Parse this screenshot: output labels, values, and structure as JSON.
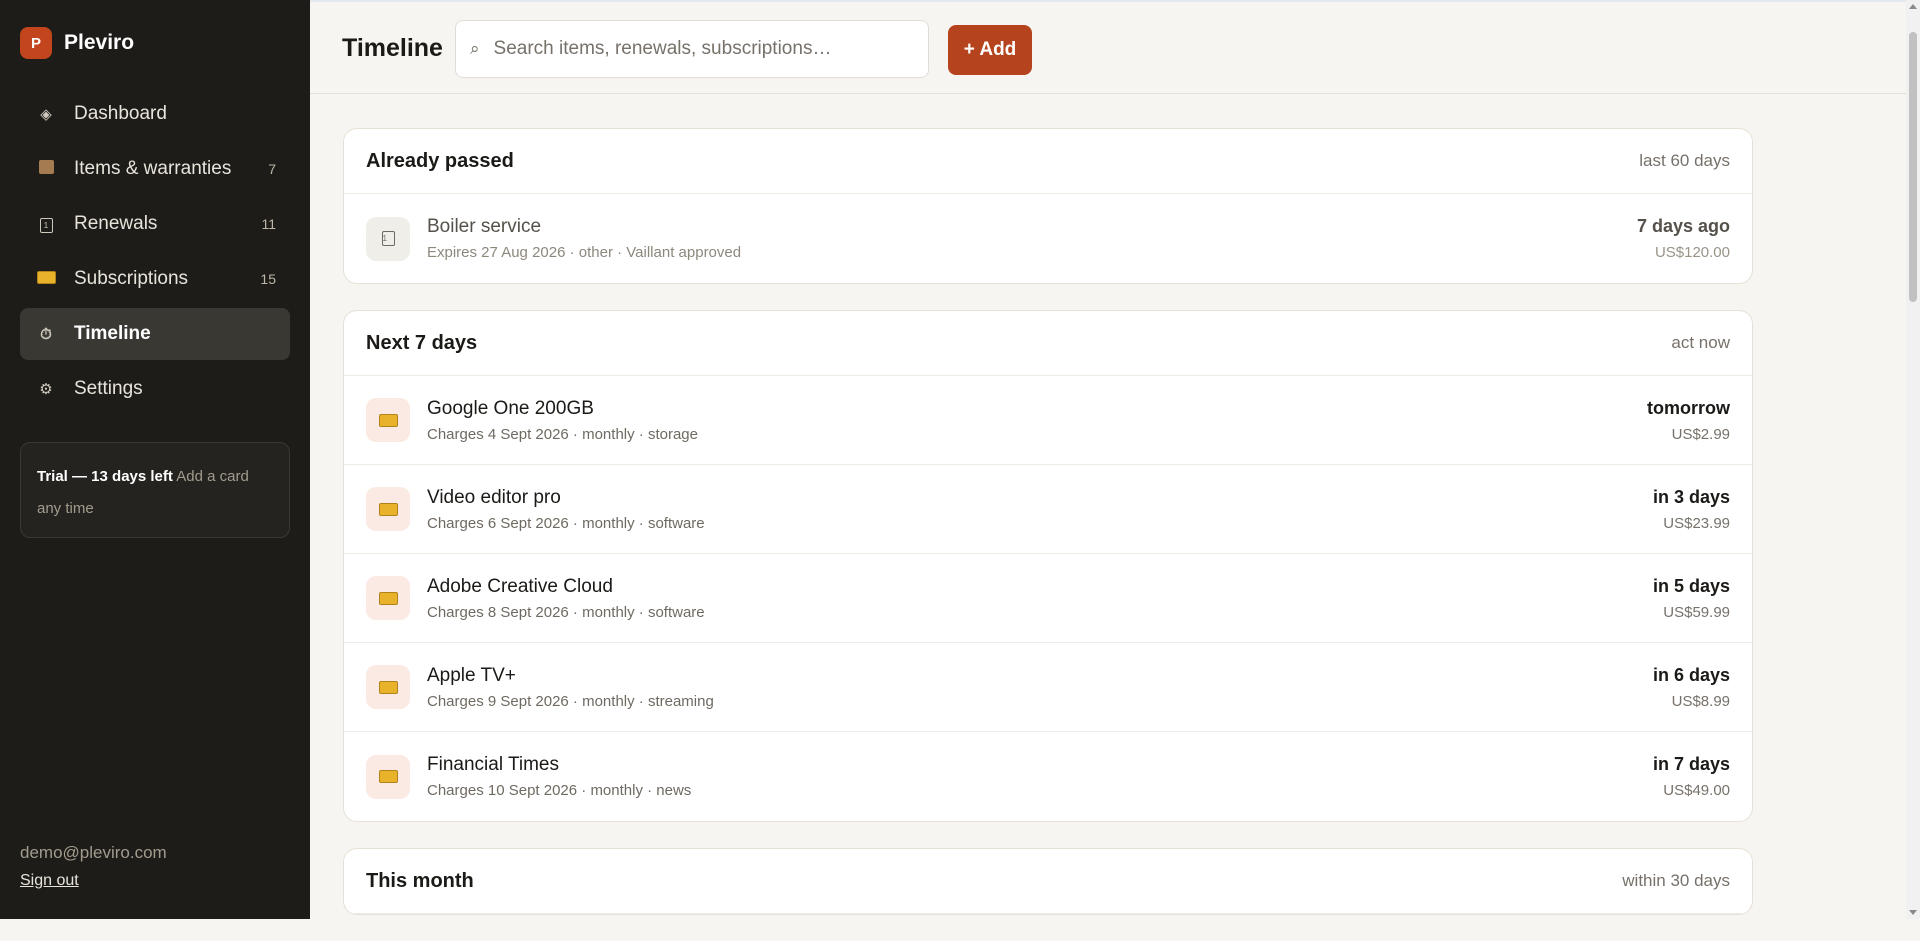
{
  "app": {
    "name": "Pleviro",
    "logo_letter": "P"
  },
  "sidebar": {
    "items": [
      {
        "label": "Dashboard",
        "icon": "diamond-icon",
        "count": ""
      },
      {
        "label": "Items & warranties",
        "icon": "box-icon",
        "count": "7"
      },
      {
        "label": "Renewals",
        "icon": "calendar-icon",
        "count": "11"
      },
      {
        "label": "Subscriptions",
        "icon": "credit-card-icon",
        "count": "15"
      },
      {
        "label": "Timeline",
        "icon": "stopwatch-icon",
        "count": "",
        "active": true
      },
      {
        "label": "Settings",
        "icon": "gear-icon",
        "count": ""
      }
    ],
    "trial": {
      "strong": "Trial — 13 days left",
      "muted": "Add a card any time"
    },
    "user_email": "demo@pleviro.com",
    "sign_out": "Sign out"
  },
  "header": {
    "title": "Timeline",
    "search_placeholder": "Search items, renewals, subscriptions…",
    "add_label": "+ Add"
  },
  "sections": [
    {
      "title": "Already passed",
      "subtitle": "last 60 days",
      "rows": [
        {
          "name": "Boiler service",
          "meta": "Expires 27 Aug 2026 · other · Vaillant approved",
          "when": "7 days ago",
          "amount": "US$120.00",
          "icon": "calendar-icon"
        }
      ]
    },
    {
      "title": "Next 7 days",
      "subtitle": "act now",
      "rows": [
        {
          "name": "Google One 200GB",
          "meta": "Charges 4 Sept 2026 · monthly · storage",
          "when": "tomorrow",
          "amount": "US$2.99",
          "icon": "credit-card-icon"
        },
        {
          "name": "Video editor pro",
          "meta": "Charges 6 Sept 2026 · monthly · software",
          "when": "in 3 days",
          "amount": "US$23.99",
          "icon": "credit-card-icon"
        },
        {
          "name": "Adobe Creative Cloud",
          "meta": "Charges 8 Sept 2026 · monthly · software",
          "when": "in 5 days",
          "amount": "US$59.99",
          "icon": "credit-card-icon"
        },
        {
          "name": "Apple TV+",
          "meta": "Charges 9 Sept 2026 · monthly · streaming",
          "when": "in 6 days",
          "amount": "US$8.99",
          "icon": "credit-card-icon"
        },
        {
          "name": "Financial Times",
          "meta": "Charges 10 Sept 2026 · monthly · news",
          "when": "in 7 days",
          "amount": "US$49.00",
          "icon": "credit-card-icon"
        }
      ]
    },
    {
      "title": "This month",
      "subtitle": "within 30 days",
      "rows": []
    }
  ],
  "colors": {
    "accent": "#b5431d",
    "sidebar_bg": "#1e1c18",
    "page_bg": "#f7f5f1"
  }
}
